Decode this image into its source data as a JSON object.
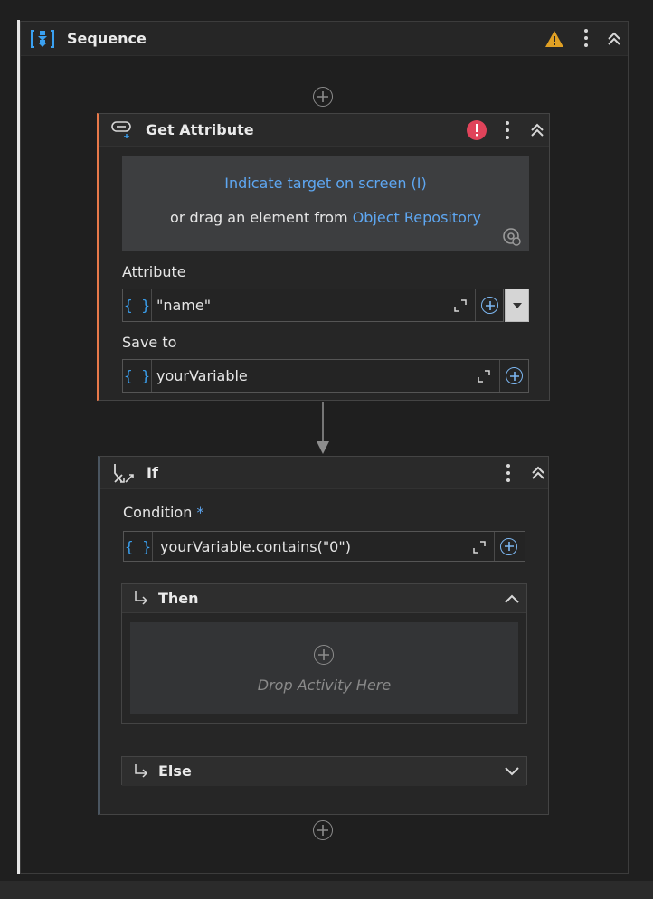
{
  "sequence": {
    "title": "Sequence",
    "icons": {
      "main": "sequence-icon",
      "warning": "warning-icon",
      "more": "more-vertical-icon",
      "collapse": "chevrons-up-icon"
    }
  },
  "get_attribute": {
    "title": "Get Attribute",
    "target": {
      "indicate_link": "Indicate target on screen (I)",
      "drag_text": "or drag an element from",
      "repository_link": "Object Repository"
    },
    "attribute": {
      "label": "Attribute",
      "value": "\"name\""
    },
    "save_to": {
      "label": "Save to",
      "value": "yourVariable"
    },
    "icons": {
      "main": "get-attribute-icon",
      "error": "error-icon",
      "target": "target-settings-icon"
    }
  },
  "if_activity": {
    "title": "If",
    "condition": {
      "label": "Condition",
      "required_mark": "*",
      "value": "yourVariable.contains(\"0\")"
    },
    "then": {
      "label": "Then",
      "drop_text": "Drop Activity Here"
    },
    "else": {
      "label": "Else"
    },
    "icons": {
      "main": "if-branch-icon",
      "branch": "branch-arrow-icon"
    }
  },
  "colors": {
    "accent": "#5ea7f2",
    "brace": "#3aa0f0",
    "warning": "#e0a024",
    "error": "#e0435a",
    "selected_border": "#e8794a"
  }
}
